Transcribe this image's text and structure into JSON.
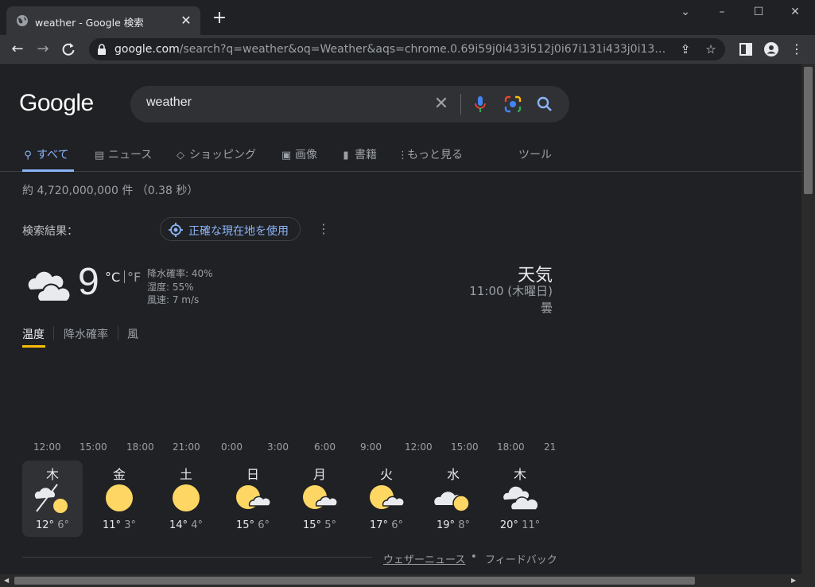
{
  "browser": {
    "tab_title": "weather - Google 検索",
    "tab_close": "✕",
    "new_tab": "+",
    "url_host": "google.com",
    "url_path": "/search?q=weather&oq=Weather&aqs=chrome.0.69i59j0i433i512j0i67i131i433j0i131i433j0i67i13...",
    "window_controls": [
      "⌄",
      "–",
      "☐",
      "✕"
    ]
  },
  "google": {
    "logo": "Google",
    "query": "weather",
    "tabs": [
      {
        "label": "すべて",
        "icon": "search-icon",
        "active": true
      },
      {
        "label": "ニュース",
        "icon": "news-icon"
      },
      {
        "label": "ショッピング",
        "icon": "tag-icon"
      },
      {
        "label": "画像",
        "icon": "image-icon"
      },
      {
        "label": "書籍",
        "icon": "book-icon"
      },
      {
        "label": "もっと見る",
        "icon": "more-vert-icon"
      },
      {
        "label": "ツール"
      }
    ],
    "stats": "約 4,720,000,000 件 （0.38 秒）",
    "results_label": "検索結果：",
    "location_button": "正確な現在地を使用"
  },
  "weather": {
    "temp": "9",
    "unit_c": "°C",
    "unit_f": "°F",
    "precip": "降水確率: 40%",
    "humidity": "湿度: 55%",
    "wind": "風速: 7 m/s",
    "title": "天気",
    "time": "11:00 (木曜日)",
    "condition": "曇",
    "chart_tabs": [
      "温度",
      "降水確率",
      "風"
    ],
    "hours": [
      "12:00",
      "15:00",
      "18:00",
      "21:00",
      "0:00",
      "3:00",
      "6:00",
      "9:00",
      "12:00",
      "15:00",
      "18:00",
      "21"
    ],
    "days": [
      {
        "name": "木",
        "hi": "12°",
        "lo": "6°",
        "icon": "cloudy-sun-icon",
        "selected": true
      },
      {
        "name": "金",
        "hi": "11°",
        "lo": "3°",
        "icon": "sunny-icon"
      },
      {
        "name": "土",
        "hi": "14°",
        "lo": "4°",
        "icon": "sunny-icon"
      },
      {
        "name": "日",
        "hi": "15°",
        "lo": "6°",
        "icon": "partly-cloudy-icon"
      },
      {
        "name": "月",
        "hi": "15°",
        "lo": "5°",
        "icon": "partly-cloudy-icon"
      },
      {
        "name": "火",
        "hi": "17°",
        "lo": "6°",
        "icon": "partly-cloudy-icon"
      },
      {
        "name": "水",
        "hi": "19°",
        "lo": "8°",
        "icon": "mostly-cloudy-icon"
      },
      {
        "name": "木",
        "hi": "20°",
        "lo": "11°",
        "icon": "cloudy-icon"
      }
    ],
    "footer_news": "ウェザーニュース",
    "footer_dot": "•",
    "footer_feedback": "フィードバック"
  },
  "colors": {
    "link": "#8ab4f8",
    "sun": "#fdd663",
    "background": "#202124"
  }
}
